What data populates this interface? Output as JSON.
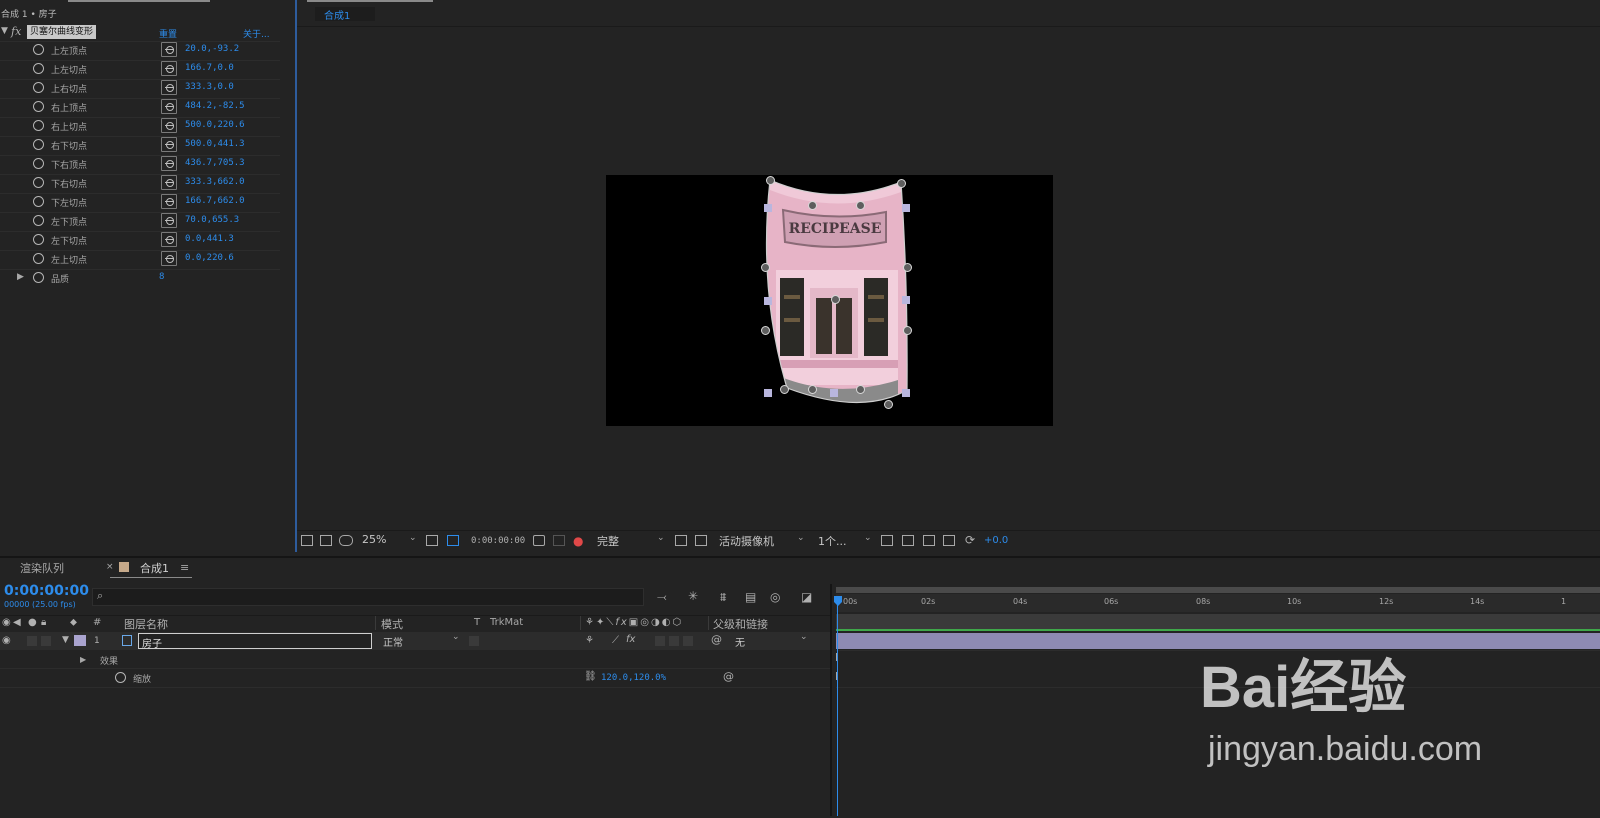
{
  "effects": {
    "header_label": "合成 1 • 房子",
    "effect_name": "贝塞尔曲线变形",
    "reset_label": "重置",
    "about_label": "关于...",
    "params": [
      {
        "name": "上左顶点",
        "value": "20.0,-93.2"
      },
      {
        "name": "上左切点",
        "value": "166.7,0.0"
      },
      {
        "name": "上右切点",
        "value": "333.3,0.0"
      },
      {
        "name": "右上顶点",
        "value": "484.2,-82.5"
      },
      {
        "name": "右上切点",
        "value": "500.0,220.6"
      },
      {
        "name": "右下切点",
        "value": "500.0,441.3"
      },
      {
        "name": "下右顶点",
        "value": "436.7,705.3"
      },
      {
        "name": "下右切点",
        "value": "333.3,662.0"
      },
      {
        "name": "下左切点",
        "value": "166.7,662.0"
      },
      {
        "name": "左下顶点",
        "value": "70.0,655.3"
      },
      {
        "name": "左下切点",
        "value": "0.0,441.3"
      },
      {
        "name": "左上切点",
        "value": "0.0,220.6"
      }
    ],
    "quality_label": "品质",
    "quality_value": "8"
  },
  "viewer": {
    "tab_label": "合成1",
    "zoom": "25%",
    "timecode": "0:00:00:00",
    "resolution": "完整",
    "camera": "活动摄像机",
    "views": "1个...",
    "exposure": "+0.0",
    "sign_text": "RECIPEASE"
  },
  "timeline": {
    "render_queue_tab": "渲染队列",
    "comp_tab": "合成1",
    "current_time": "0:00:00:00",
    "frame_info": "00000 (25.00 fps)",
    "search_placeholder": "",
    "columns": {
      "number": "#",
      "layer_name": "图层名称",
      "mode": "模式",
      "t": "T",
      "trkmat": "TrkMat",
      "parent": "父级和链接"
    },
    "layer": {
      "index": "1",
      "name": "房子",
      "mode": "正常",
      "parent": "无"
    },
    "effects_row": "效果",
    "scale_row": {
      "name": "缩放",
      "value": "120.0,120.0%"
    },
    "ruler": [
      "00s",
      "02s",
      "04s",
      "06s",
      "08s",
      "10s",
      "12s",
      "14s",
      "1"
    ]
  },
  "watermark": {
    "text": "Bai经验",
    "url": "jingyan.baidu.com"
  }
}
